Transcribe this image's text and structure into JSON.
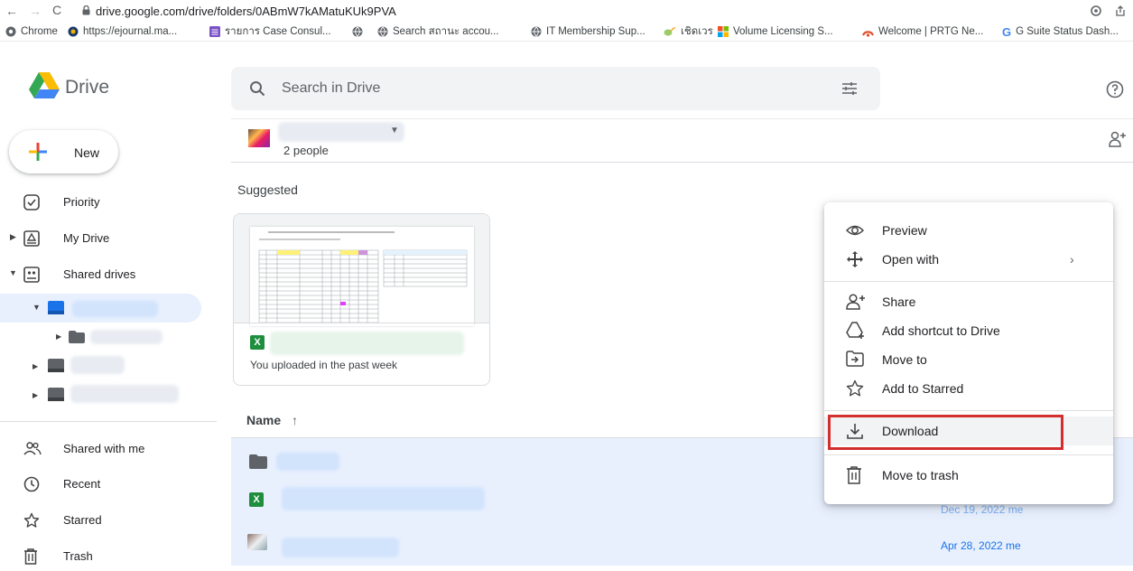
{
  "browser": {
    "url": "drive.google.com/drive/folders/0ABmW7kAMatuKUk9PVA",
    "bookmarks": [
      {
        "label": "Chrome",
        "icon": "chrome-globe-icon"
      },
      {
        "label": "https://ejournal.ma...",
        "icon": "site-icon"
      },
      {
        "label": "รายการ Case Consul...",
        "icon": "sheets-icon"
      },
      {
        "label": "",
        "icon": "globe-icon"
      },
      {
        "label": "Search สถานะ accou...",
        "icon": "globe-icon"
      },
      {
        "label": "IT Membership Sup...",
        "icon": "globe-icon"
      },
      {
        "label": "เชิดเวร",
        "icon": "leaf-icon"
      },
      {
        "label": "Volume Licensing S...",
        "icon": "microsoft-icon"
      },
      {
        "label": "Welcome | PRTG Ne...",
        "icon": "prtg-icon"
      },
      {
        "label": "G Suite Status Dash...",
        "icon": "google-g-icon"
      }
    ]
  },
  "drive": {
    "logo_label": "Drive",
    "search_placeholder": "Search in Drive",
    "new_label": "New",
    "nav": [
      {
        "label": "Priority",
        "icon": "priority-check-icon"
      },
      {
        "label": "My Drive",
        "icon": "my-drive-icon"
      },
      {
        "label": "Shared drives",
        "icon": "shared-drives-icon"
      }
    ],
    "nav_bottom": [
      {
        "label": "Shared with me",
        "icon": "people-icon"
      },
      {
        "label": "Recent",
        "icon": "clock-icon"
      },
      {
        "label": "Starred",
        "icon": "star-icon"
      },
      {
        "label": "Trash",
        "icon": "trash-icon"
      }
    ],
    "header_people": "2 people",
    "suggested_label": "Suggested",
    "suggested_card_subtitle": "You uploaded in the past week",
    "list_header_name": "Name",
    "rows": [
      {
        "date": ""
      },
      {
        "date": "Dec 19, 2022 me"
      },
      {
        "date": "Apr 28, 2022 me"
      }
    ]
  },
  "context_menu": {
    "items": [
      {
        "label": "Preview",
        "icon": "eye-icon"
      },
      {
        "label": "Open with",
        "icon": "move-arrows-icon"
      },
      {
        "label": "Share",
        "icon": "person-add-icon"
      },
      {
        "label": "Add shortcut to Drive",
        "icon": "add-shortcut-icon"
      },
      {
        "label": "Move to",
        "icon": "move-to-icon"
      },
      {
        "label": "Add to Starred",
        "icon": "star-outline-icon"
      },
      {
        "label": "Download",
        "icon": "download-icon"
      },
      {
        "label": "Move to trash",
        "icon": "trash-icon"
      }
    ],
    "highlight_color": "#d32f2f"
  }
}
